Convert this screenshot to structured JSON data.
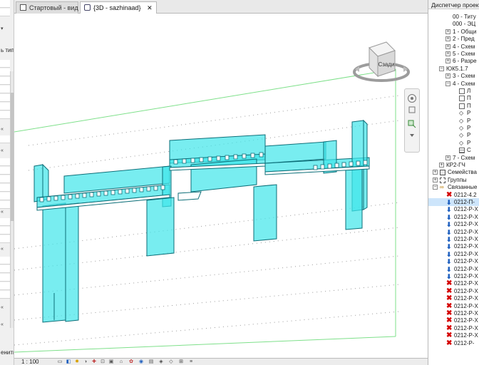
{
  "left_panel": {
    "type_label": "ь тип",
    "bottom_label": "енить"
  },
  "tabs": [
    {
      "label": "Стартовый - вид",
      "icon": "document-icon",
      "active": false
    },
    {
      "label": "{3D - sazhinaad}",
      "icon": "3d-view-icon",
      "active": true,
      "close": "✕"
    }
  ],
  "viewcube": {
    "face_label": "Сзади"
  },
  "status_bar": {
    "scale": "1 : 100"
  },
  "project_browser": {
    "title": "Диспетчер проекта",
    "rows": [
      {
        "label": "00 - Титу",
        "indent": 2,
        "expander": "",
        "icon": ""
      },
      {
        "label": "000 - ЭЦ",
        "indent": 2,
        "expander": "",
        "icon": ""
      },
      {
        "label": "1 - Общи",
        "indent": 2,
        "expander": "+",
        "icon": ""
      },
      {
        "label": "2 - Пред",
        "indent": 2,
        "expander": "+",
        "icon": ""
      },
      {
        "label": "4 - Схем",
        "indent": 2,
        "expander": "+",
        "icon": ""
      },
      {
        "label": "5 - Схем",
        "indent": 2,
        "expander": "+",
        "icon": ""
      },
      {
        "label": "6 - Разре",
        "indent": 2,
        "expander": "+",
        "icon": ""
      },
      {
        "label": "ЮК5.1.7",
        "indent": 1,
        "expander": "−",
        "icon": ""
      },
      {
        "label": "3 - Схем",
        "indent": 2,
        "expander": "+",
        "icon": ""
      },
      {
        "label": "4 - Схем",
        "indent": 2,
        "expander": "−",
        "icon": ""
      },
      {
        "label": "Л",
        "indent": 3,
        "expander": "",
        "icon": "sheet"
      },
      {
        "label": "П",
        "indent": 3,
        "expander": "",
        "icon": "sheet"
      },
      {
        "label": "П",
        "indent": 3,
        "expander": "",
        "icon": "sheet"
      },
      {
        "label": "Р",
        "indent": 3,
        "expander": "",
        "icon": "section"
      },
      {
        "label": "Р",
        "indent": 3,
        "expander": "",
        "icon": "section"
      },
      {
        "label": "Р",
        "indent": 3,
        "expander": "",
        "icon": "section"
      },
      {
        "label": "Р",
        "indent": 3,
        "expander": "",
        "icon": "section"
      },
      {
        "label": "Р",
        "indent": 3,
        "expander": "",
        "icon": "section"
      },
      {
        "label": "С",
        "indent": 3,
        "expander": "",
        "icon": "schedule"
      },
      {
        "label": "7 - Схем",
        "indent": 2,
        "expander": "+",
        "icon": ""
      },
      {
        "label": "КР2-ГЧ",
        "indent": 1,
        "expander": "+",
        "icon": ""
      },
      {
        "label": "Семейства",
        "indent": 0,
        "expander": "+",
        "icon": "families"
      },
      {
        "label": "Группы",
        "indent": 0,
        "expander": "+",
        "icon": "groups"
      },
      {
        "label": "Связанные ф",
        "indent": 0,
        "expander": "−",
        "icon": "links"
      },
      {
        "label": "0212-4.2",
        "indent": 1,
        "expander": "",
        "icon": "x"
      },
      {
        "label": "0212-П-",
        "indent": 1,
        "expander": "",
        "icon": "down",
        "selected": true
      },
      {
        "label": "0212-Р-Х",
        "indent": 1,
        "expander": "",
        "icon": "down"
      },
      {
        "label": "0212-Р-Х",
        "indent": 1,
        "expander": "",
        "icon": "down"
      },
      {
        "label": "0212-Р-Х",
        "indent": 1,
        "expander": "",
        "icon": "down"
      },
      {
        "label": "0212-Р-Х",
        "indent": 1,
        "expander": "",
        "icon": "down"
      },
      {
        "label": "0212-Р-Х",
        "indent": 1,
        "expander": "",
        "icon": "down"
      },
      {
        "label": "0212-Р-Х",
        "indent": 1,
        "expander": "",
        "icon": "down"
      },
      {
        "label": "0212-Р-Х",
        "indent": 1,
        "expander": "",
        "icon": "down"
      },
      {
        "label": "0212-Р-Х",
        "indent": 1,
        "expander": "",
        "icon": "down"
      },
      {
        "label": "0212-Р-Х",
        "indent": 1,
        "expander": "",
        "icon": "down"
      },
      {
        "label": "0212-Р-Х",
        "indent": 1,
        "expander": "",
        "icon": "down"
      },
      {
        "label": "0212-Р-Х",
        "indent": 1,
        "expander": "",
        "icon": "x"
      },
      {
        "label": "0212-Р-Х",
        "indent": 1,
        "expander": "",
        "icon": "x"
      },
      {
        "label": "0212-Р-Х",
        "indent": 1,
        "expander": "",
        "icon": "x"
      },
      {
        "label": "0212-Р-Х",
        "indent": 1,
        "expander": "",
        "icon": "x"
      },
      {
        "label": "0212-Р-Х",
        "indent": 1,
        "expander": "",
        "icon": "x"
      },
      {
        "label": "0212-Р-Х",
        "indent": 1,
        "expander": "",
        "icon": "x"
      },
      {
        "label": "0212-Р-Х",
        "indent": 1,
        "expander": "",
        "icon": "x"
      },
      {
        "label": "0212-Р-Х",
        "indent": 1,
        "expander": "",
        "icon": "x"
      },
      {
        "label": "0212-Р-",
        "indent": 1,
        "expander": "",
        "icon": "x"
      }
    ]
  },
  "colors": {
    "model_fill": "#3ee6ea",
    "model_stroke": "#0c6e78",
    "link_error": "#d40000",
    "link_loaded": "#1e5fbf",
    "crop_box": "#7ee08a"
  }
}
